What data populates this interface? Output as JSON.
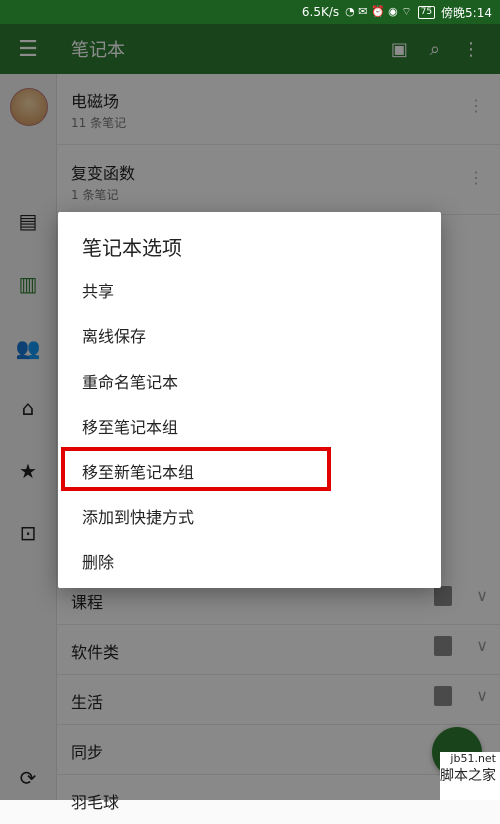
{
  "status_bar": {
    "speed": "6.5K/s",
    "battery": "75",
    "time": "傍晚5:14"
  },
  "app_bar": {
    "title": "笔记本"
  },
  "notebooks": [
    {
      "name": "电磁场",
      "count": "11 条笔记"
    },
    {
      "name": "复变函数",
      "count": "1 条笔记"
    },
    {
      "name": "课程"
    },
    {
      "name": "软件类"
    },
    {
      "name": "生活"
    },
    {
      "name": "同步"
    },
    {
      "name": "羽毛球"
    }
  ],
  "dialog": {
    "title": "笔记本选项",
    "options": [
      "共享",
      "离线保存",
      "重命名笔记本",
      "移至笔记本组",
      "移至新笔记本组",
      "添加到快捷方式",
      "删除"
    ]
  },
  "watermark": {
    "line1": "jb51.net",
    "line2": "脚本之家"
  },
  "colors": {
    "primary": "#2e7d32",
    "status_bar": "#1b5e20",
    "highlight": "#e10000"
  },
  "icons": [
    "menu-icon",
    "notebook-add-icon",
    "search-icon",
    "more-vert-icon",
    "note-icon",
    "notebook-icon",
    "people-icon",
    "tag-icon",
    "star-icon",
    "trash-icon",
    "sync-icon"
  ]
}
